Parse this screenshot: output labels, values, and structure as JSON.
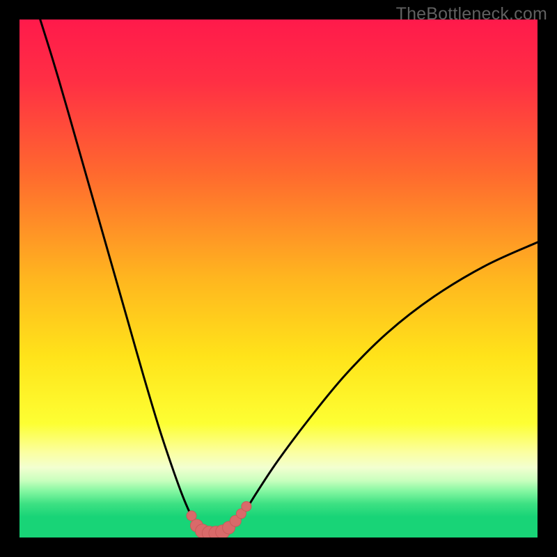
{
  "watermark": "TheBottleneck.com",
  "chart_data": {
    "type": "line",
    "title": "",
    "xlabel": "",
    "ylabel": "",
    "xlim": [
      0,
      100
    ],
    "ylim": [
      0,
      100
    ],
    "gradient_stops": [
      {
        "offset": 0.0,
        "color": "#ff1a4b"
      },
      {
        "offset": 0.12,
        "color": "#ff2f44"
      },
      {
        "offset": 0.3,
        "color": "#ff6a2e"
      },
      {
        "offset": 0.5,
        "color": "#ffb61f"
      },
      {
        "offset": 0.65,
        "color": "#ffe31a"
      },
      {
        "offset": 0.78,
        "color": "#fdff33"
      },
      {
        "offset": 0.835,
        "color": "#fbffa0"
      },
      {
        "offset": 0.865,
        "color": "#f2ffd0"
      },
      {
        "offset": 0.89,
        "color": "#c9ffbe"
      },
      {
        "offset": 0.91,
        "color": "#86f7a2"
      },
      {
        "offset": 0.935,
        "color": "#3de183"
      },
      {
        "offset": 0.96,
        "color": "#18d477"
      },
      {
        "offset": 1.0,
        "color": "#18d477"
      }
    ],
    "series": [
      {
        "name": "left-curve",
        "x": [
          4.0,
          6.5,
          9.0,
          12.0,
          15.0,
          18.0,
          21.0,
          24.0,
          27.0,
          29.5,
          31.5,
          33.0,
          34.0,
          34.6
        ],
        "y": [
          100.0,
          92.0,
          83.5,
          73.0,
          62.5,
          52.0,
          41.5,
          31.0,
          21.0,
          13.5,
          8.0,
          4.5,
          2.5,
          1.6
        ]
      },
      {
        "name": "right-curve",
        "x": [
          41.0,
          42.0,
          43.5,
          46.0,
          50.0,
          56.0,
          63.0,
          71.0,
          80.0,
          90.0,
          100.0
        ],
        "y": [
          1.6,
          2.8,
          5.0,
          9.0,
          15.0,
          23.0,
          31.5,
          39.5,
          46.5,
          52.5,
          57.0
        ]
      }
    ],
    "markers": {
      "name": "valley-markers",
      "color": "#d96a6a",
      "stroke": "#c95a5a",
      "points": [
        {
          "x": 33.2,
          "y": 4.2,
          "r": 7
        },
        {
          "x": 34.2,
          "y": 2.3,
          "r": 9
        },
        {
          "x": 35.3,
          "y": 1.25,
          "r": 10
        },
        {
          "x": 36.6,
          "y": 0.85,
          "r": 10
        },
        {
          "x": 37.9,
          "y": 0.85,
          "r": 10
        },
        {
          "x": 39.2,
          "y": 1.1,
          "r": 10
        },
        {
          "x": 40.4,
          "y": 1.9,
          "r": 9
        },
        {
          "x": 41.7,
          "y": 3.2,
          "r": 8
        },
        {
          "x": 42.8,
          "y": 4.6,
          "r": 7
        },
        {
          "x": 43.8,
          "y": 6.0,
          "r": 7
        }
      ]
    }
  }
}
